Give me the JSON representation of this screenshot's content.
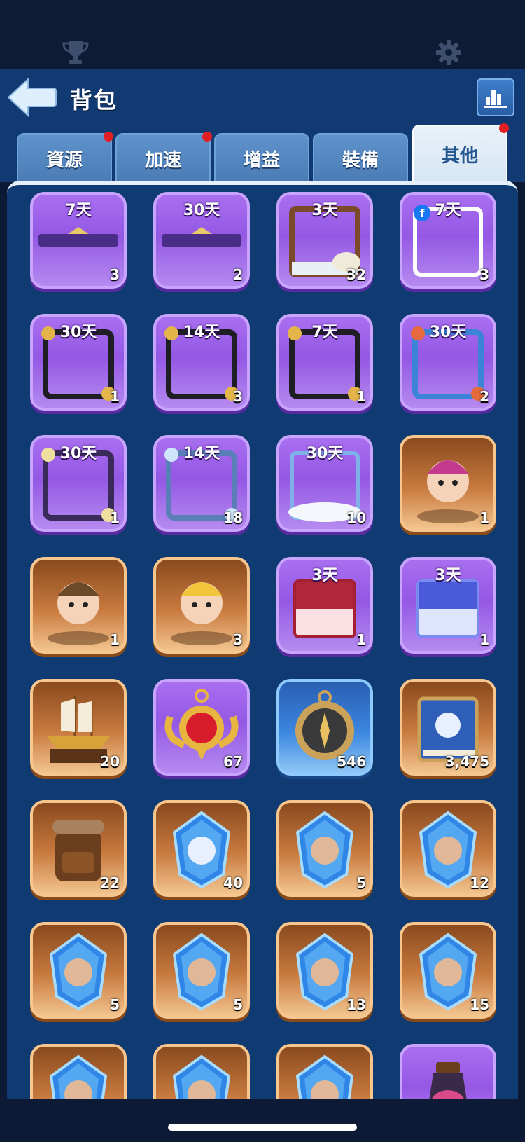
{
  "header": {
    "title": "背包"
  },
  "tabs": [
    {
      "label": "資源",
      "dot": true
    },
    {
      "label": "加速",
      "dot": true
    },
    {
      "label": "增益",
      "dot": false
    },
    {
      "label": "裝備",
      "dot": false
    },
    {
      "label": "其他",
      "dot": true,
      "active": true
    }
  ],
  "items": [
    {
      "days": "7天",
      "count": "3",
      "style": "purple",
      "icon": "nameplate-frame-icon"
    },
    {
      "days": "30天",
      "count": "2",
      "style": "purple",
      "icon": "nameplate-frame-icon"
    },
    {
      "days": "3天",
      "count": "32",
      "style": "purple",
      "icon": "skull-avatar-frame-icon"
    },
    {
      "days": "7天",
      "count": "3",
      "style": "purple",
      "icon": "facebook-avatar-frame-icon"
    },
    {
      "days": "30天",
      "count": "1",
      "style": "purple",
      "icon": "gold-avatar-frame-icon"
    },
    {
      "days": "14天",
      "count": "3",
      "style": "purple",
      "icon": "gold-avatar-frame-icon"
    },
    {
      "days": "7天",
      "count": "1",
      "style": "purple",
      "icon": "gold-avatar-frame-icon"
    },
    {
      "days": "30天",
      "count": "2",
      "style": "purple",
      "icon": "ocean-avatar-frame-icon"
    },
    {
      "days": "30天",
      "count": "1",
      "style": "purple",
      "icon": "star-avatar-frame-icon"
    },
    {
      "days": "14天",
      "count": "18",
      "style": "purple",
      "icon": "ice-avatar-frame-icon"
    },
    {
      "days": "30天",
      "count": "10",
      "style": "purple",
      "icon": "cloud-avatar-frame-icon"
    },
    {
      "days": "",
      "count": "1",
      "style": "orange",
      "icon": "pirate-girl-icon"
    },
    {
      "days": "",
      "count": "1",
      "style": "orange",
      "icon": "aviator-hero-icon"
    },
    {
      "days": "",
      "count": "3",
      "style": "orange",
      "icon": "detective-hero-icon"
    },
    {
      "days": "3天",
      "count": "1",
      "style": "purple",
      "icon": "red-chat-bubble-icon"
    },
    {
      "days": "3天",
      "count": "1",
      "style": "purple",
      "icon": "blue-chat-bubble-icon"
    },
    {
      "days": "",
      "count": "20",
      "style": "orange",
      "icon": "ship-trophy-icon"
    },
    {
      "days": "",
      "count": "67",
      "style": "purple",
      "icon": "ruby-medal-icon"
    },
    {
      "days": "",
      "count": "546",
      "style": "blue",
      "icon": "compass-icon"
    },
    {
      "days": "",
      "count": "3,475",
      "style": "orange",
      "icon": "skill-book-icon"
    },
    {
      "days": "",
      "count": "22",
      "style": "orange",
      "icon": "backpack-icon"
    },
    {
      "days": "",
      "count": "40",
      "style": "orange",
      "icon": "captain-crystal-icon"
    },
    {
      "days": "",
      "count": "5",
      "style": "orange",
      "icon": "hero-crystal-icon"
    },
    {
      "days": "",
      "count": "12",
      "style": "orange",
      "icon": "hero-crystal-icon"
    },
    {
      "days": "",
      "count": "5",
      "style": "orange",
      "icon": "hero-crystal-icon"
    },
    {
      "days": "",
      "count": "5",
      "style": "orange",
      "icon": "hero-crystal-icon"
    },
    {
      "days": "",
      "count": "13",
      "style": "orange",
      "icon": "hero-crystal-icon"
    },
    {
      "days": "",
      "count": "15",
      "style": "orange",
      "icon": "hero-crystal-icon"
    },
    {
      "days": "",
      "count": "",
      "style": "orange",
      "icon": "hero-crystal-icon"
    },
    {
      "days": "",
      "count": "",
      "style": "orange",
      "icon": "hero-crystal-icon"
    },
    {
      "days": "",
      "count": "",
      "style": "orange",
      "icon": "hero-crystal-icon"
    },
    {
      "days": "",
      "count": "",
      "style": "purple",
      "icon": "potion-icon"
    }
  ]
}
